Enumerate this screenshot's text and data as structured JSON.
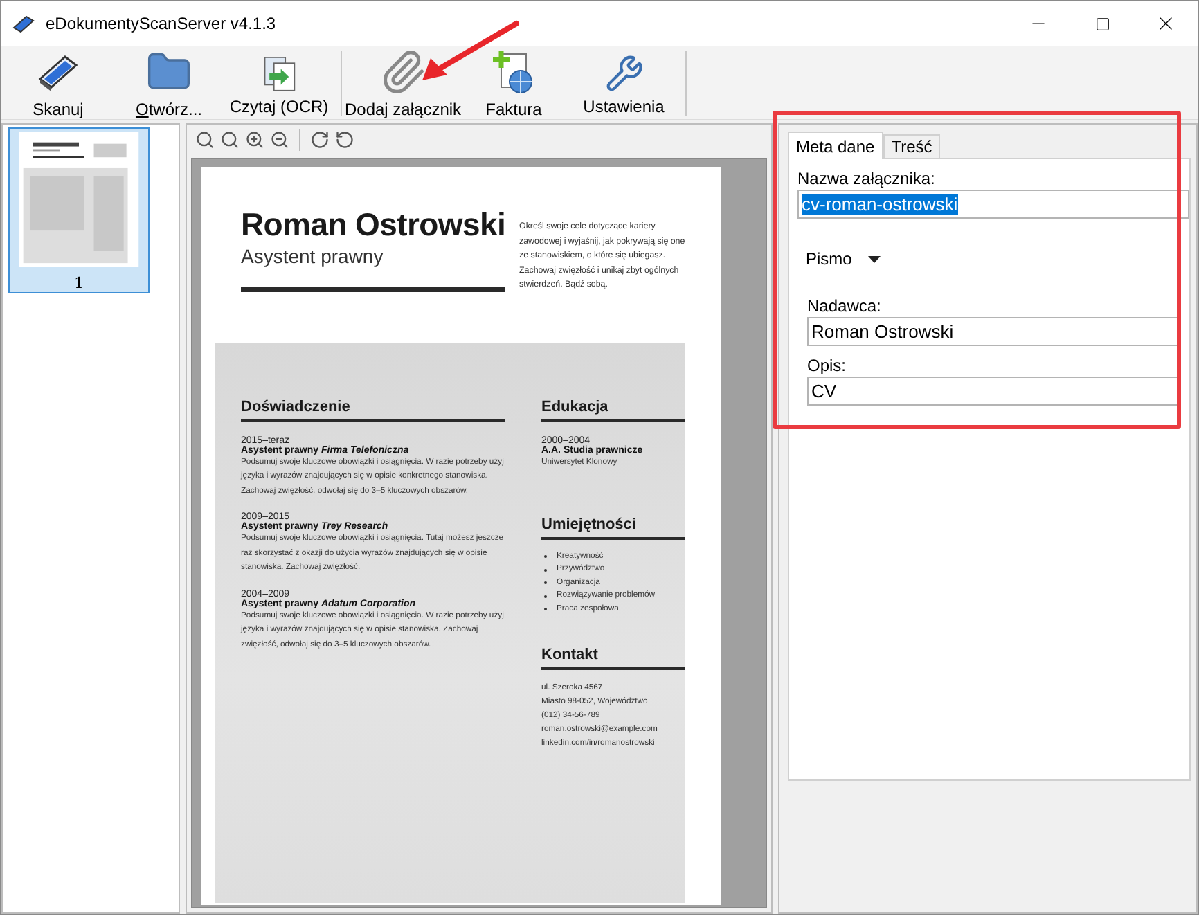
{
  "window": {
    "title": "eDokumentyScanServer v4.1.3"
  },
  "toolbar": [
    {
      "label": "Skanuj",
      "kind": "scanner",
      "underline_first": false,
      "separator_after": false
    },
    {
      "label": "Otwórz...",
      "kind": "folder",
      "underline_first": true,
      "separator_after": false
    },
    {
      "label": "Czytaj (OCR)",
      "kind": "ocr",
      "underline_first": false,
      "separator_after": true
    },
    {
      "label": "Dodaj załącznik",
      "kind": "attach",
      "underline_first": false,
      "separator_after": false
    },
    {
      "label": "Faktura",
      "kind": "invoice",
      "underline_first": false,
      "separator_after": false
    },
    {
      "label": "Ustawienia",
      "kind": "settings",
      "underline_first": false,
      "separator_after": true
    }
  ],
  "thumbnails": [
    {
      "label": "1",
      "selected": true
    }
  ],
  "document": {
    "name": "Roman Ostrowski",
    "subtitle": "Asystent prawny",
    "intro": "Określ swoje cele dotyczące kariery zawodowej i wyjaśnij, jak pokrywają się one ze stanowiskiem, o które się ubiegasz. Zachowaj zwięzłość i unikaj zbyt ogólnych stwierdzeń. Bądź sobą.",
    "experience": {
      "heading": "Doświadczenie",
      "jobs": [
        {
          "years": "2015–teraz",
          "title": "Asystent prawny *Firma Telefoniczna*",
          "text": "Podsumuj swoje kluczowe obowiązki i osiągnięcia. W razie potrzeby użyj języka i wyrazów znajdujących się w opisie konkretnego stanowiska. Zachowaj zwięzłość, odwołaj się do 3–5 kluczowych obszarów."
        },
        {
          "years": "2009–2015",
          "title": "Asystent prawny *Trey Research*",
          "text": "Podsumuj swoje kluczowe obowiązki i osiągnięcia. Tutaj możesz jeszcze raz skorzystać z okazji do użycia wyrazów znajdujących się w opisie stanowiska. Zachowaj zwięzłość."
        },
        {
          "years": "2004–2009",
          "title": "Asystent prawny *Adatum Corporation*",
          "text": "Podsumuj swoje kluczowe obowiązki i osiągnięcia. W razie potrzeby użyj języka i wyrazów znajdujących się w opisie stanowiska. Zachowaj zwięzłość, odwołaj się do 3–5 kluczowych obszarów."
        }
      ]
    },
    "education": {
      "heading": "Edukacja",
      "years": "2000–2004",
      "degree": "A.A. Studia prawnicze",
      "school": "Uniwersytet Klonowy"
    },
    "skills": {
      "heading": "Umiejętności",
      "items": [
        "Kreatywność",
        "Przywództwo",
        "Organizacja",
        "Rozwiązywanie problemów",
        "Praca zespołowa"
      ]
    },
    "contact": {
      "heading": "Kontakt",
      "lines": [
        "ul. Szeroka 4567",
        "Miasto 98-052, Województwo",
        "(012) 34-56-789",
        "roman.ostrowski@example.com",
        "linkedin.com/in/romanostrowski"
      ]
    }
  },
  "panel": {
    "tabs": [
      {
        "label": "Meta dane",
        "selected": true
      },
      {
        "label": "Treść",
        "selected": false
      }
    ],
    "name_label": "Nazwa załącznika:",
    "name_value": "cv-roman-ostrowski",
    "name_value_selected": true,
    "type_dropdown": "Pismo",
    "sender_label": "Nadawca:",
    "sender_value": "Roman Ostrowski",
    "description_label": "Opis:",
    "description_value": "CV"
  }
}
